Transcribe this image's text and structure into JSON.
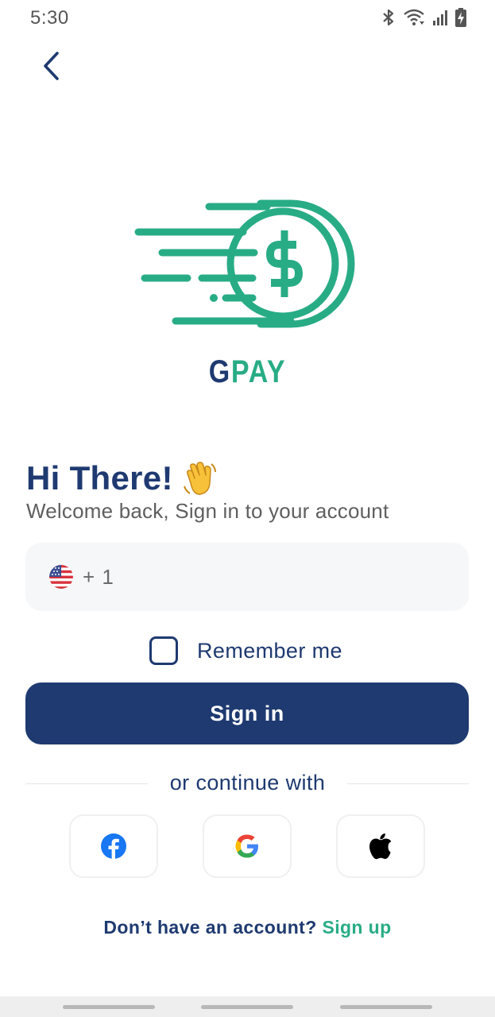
{
  "status_bar": {
    "time": "5:30",
    "icons": [
      "bluetooth-icon",
      "wifi-icon",
      "signal-icon",
      "battery-charging-icon"
    ]
  },
  "nav": {
    "back_icon": "chevron-left-icon"
  },
  "brand": {
    "name_first": "G",
    "name_rest": "PAY"
  },
  "greeting": {
    "title": "Hi There!",
    "emoji": "waving-hand-icon",
    "subtitle": "Welcome back, Sign in to your account"
  },
  "phone": {
    "flag": "us-flag-icon",
    "country_code": "+ 1",
    "value": "",
    "placeholder": ""
  },
  "remember_me": {
    "label": "Remember me",
    "checked": false
  },
  "actions": {
    "sign_in_label": "Sign in"
  },
  "divider": {
    "text": "or continue with"
  },
  "social": [
    {
      "name": "facebook",
      "icon": "facebook-icon"
    },
    {
      "name": "google",
      "icon": "google-icon"
    },
    {
      "name": "apple",
      "icon": "apple-icon"
    }
  ],
  "signup": {
    "prompt": "Don’t have an account?",
    "link": "Sign up"
  },
  "colors": {
    "primary": "#1e3a70",
    "accent": "#28ac86",
    "field_bg": "#f6f7f8"
  }
}
